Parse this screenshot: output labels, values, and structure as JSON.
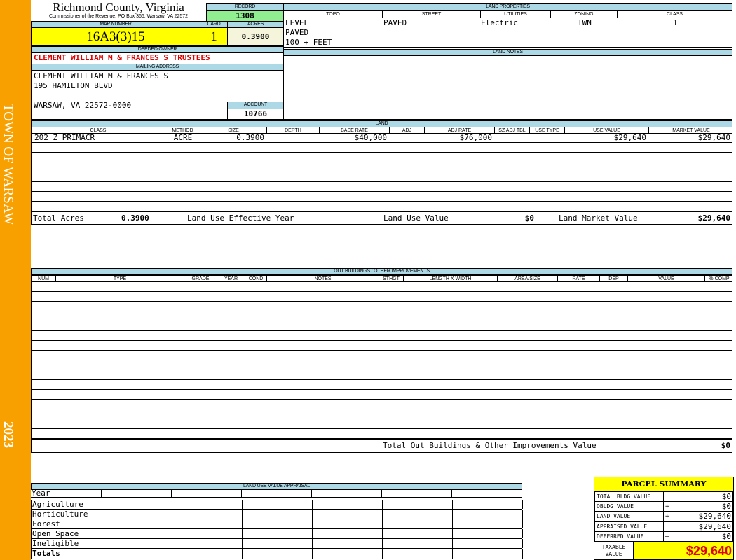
{
  "sidebar": {
    "town": "TOWN OF WARSAW",
    "year": "2023",
    "color": "#f7a000"
  },
  "header": {
    "county": "Richmond County, Virginia",
    "office": "Commissioner of the Revenue, PO Box 366, Warsaw, VA 22572"
  },
  "record": {
    "label": "RECORD",
    "value": "1308"
  },
  "map": {
    "label": "MAP NUMBER",
    "value": "16A3(3)15"
  },
  "card": {
    "label": "CARD",
    "value": "1"
  },
  "acres": {
    "label": "ACRES",
    "value": "0.3900"
  },
  "owner": {
    "label": "DEEDED OWNER",
    "value": "CLEMENT WILLIAM M & FRANCES S TRUSTEES"
  },
  "mailing": {
    "label": "MAILING ADDRESS",
    "lines": [
      "CLEMENT WILLIAM M & FRANCES S",
      "195 HAMILTON BLVD",
      "",
      "WARSAW, VA 22572-0000"
    ]
  },
  "account": {
    "label": "ACCOUNT",
    "value": "10766"
  },
  "land_properties": {
    "label": "LAND PROPERTIES",
    "columns": [
      "TOPO",
      "STREET",
      "UTILITIES",
      "ZONING",
      "CLASS"
    ],
    "topo": [
      "LEVEL",
      "PAVED",
      "100 + FEET"
    ],
    "street": "PAVED",
    "utilities": "Electric",
    "zoning": "TWN",
    "class": "1"
  },
  "land_notes": {
    "label": "LAND NOTES"
  },
  "land": {
    "label": "LAND",
    "columns": [
      "CLASS",
      "METHOD",
      "SIZE",
      "DEPTH",
      "BASE RATE",
      "ADJ",
      "ADJ RATE",
      "SZ ADJ TBL",
      "USE TYPE",
      "USE VALUE",
      "MARKET VALUE"
    ],
    "rows": [
      [
        "202 Z PRIMACR",
        "ACRE",
        "0.3900",
        "",
        "$40,000",
        "",
        "$76,000",
        "",
        "",
        "$29,640",
        "$29,640"
      ]
    ],
    "totals": {
      "acres_label": "Total Acres",
      "acres": "0.3900",
      "effective_year_label": "Land Use Effective Year",
      "use_value_label": "Land Use Value",
      "use_value": "$0",
      "market_value_label": "Land Market Value",
      "market_value": "$29,640"
    }
  },
  "outbuildings": {
    "label": "OUT BUILDINGS / OTHER IMPROVEMENTS",
    "columns": [
      "NUM",
      "TYPE",
      "GRADE",
      "YEAR",
      "COND",
      "NOTES",
      "STHGT",
      "LENGTH X WIDTH",
      "AREA/SIZE",
      "RATE",
      "DEP",
      "VALUE",
      "% COMP"
    ],
    "total_label": "Total Out Buildings & Other Improvements Value",
    "total": "$0"
  },
  "land_use": {
    "label": "LAND USE VALUE APPRAISAL",
    "year_label": "Year",
    "rows": [
      "Agriculture",
      "Horticulture",
      "Forest",
      "Open Space",
      "Ineligible"
    ],
    "totals_label": "Totals"
  },
  "parcel_summary": {
    "title": "PARCEL SUMMARY",
    "rows": [
      {
        "label": "TOTAL BLDG VALUE",
        "op": "",
        "value": "$0"
      },
      {
        "label": "OBLDG VALUE",
        "op": "+",
        "value": "$0"
      },
      {
        "label": "LAND VALUE",
        "op": "+",
        "value": "$29,640"
      },
      {
        "label": "APPRAISED VALUE",
        "op": "",
        "value": "$29,640"
      },
      {
        "label": "DEFERRED VALUE",
        "op": "–",
        "value": "$0"
      }
    ],
    "taxable_label": "TAXABLE VALUE",
    "taxable": "$29,640"
  }
}
